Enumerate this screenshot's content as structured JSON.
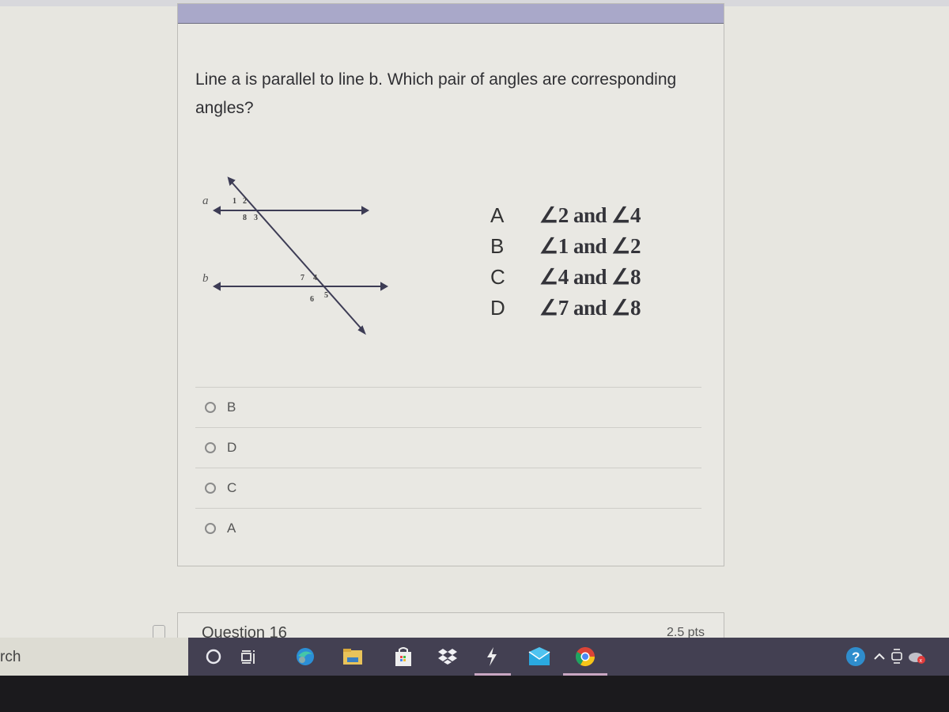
{
  "question": {
    "text": "Line a is parallel to line b. Which pair of angles are corresponding angles?",
    "figure": {
      "line_labels": [
        "a",
        "b"
      ],
      "angle_labels_top": [
        "1",
        "2",
        "8",
        "3"
      ],
      "angle_labels_bottom": [
        "7",
        "4",
        "6",
        "5"
      ]
    },
    "choices": [
      {
        "letter": "A",
        "angles": "∠2 and ∠4"
      },
      {
        "letter": "B",
        "angles": "∠1 and ∠2"
      },
      {
        "letter": "C",
        "angles": "∠4 and ∠8"
      },
      {
        "letter": "D",
        "angles": "∠7 and ∠8"
      }
    ]
  },
  "answers": [
    {
      "label": "B",
      "selected": false
    },
    {
      "label": "D",
      "selected": false
    },
    {
      "label": "C",
      "selected": false
    },
    {
      "label": "A",
      "selected": false
    }
  ],
  "next_question": {
    "title": "Question 16",
    "points": "2.5 pts"
  },
  "taskbar": {
    "search_text": "rch",
    "icons": [
      "cortana-icon",
      "task-view-icon",
      "edge-icon",
      "file-explorer-icon",
      "store-icon",
      "dropbox-icon",
      "app-icon",
      "mail-icon",
      "chrome-icon"
    ],
    "tray_icons": [
      "help-icon",
      "chevron-up-icon",
      "meet-icon",
      "onedrive-error-icon"
    ]
  }
}
